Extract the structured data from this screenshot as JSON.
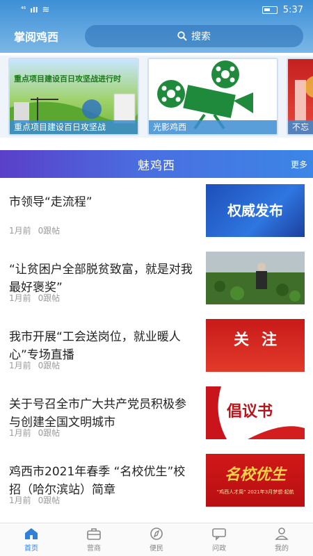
{
  "status": {
    "time": "5:37",
    "network": "⁴⁶",
    "signal": "ıll",
    "wifi": "≋"
  },
  "header": {
    "app_title": "掌阅鸡西",
    "search_label": "搜索"
  },
  "banners": [
    {
      "caption": "重点项目建设百日攻坚战",
      "image_text": "重点项目建设百日攻坚战进行时"
    },
    {
      "caption": "光影鸡西"
    },
    {
      "caption": "不忘"
    }
  ],
  "section": {
    "title": "魅鸡西",
    "more": "更多"
  },
  "articles": [
    {
      "title": "市领导“走流程”",
      "time": "1月前",
      "replies": "0跟帖",
      "thumb_text": "权威发布"
    },
    {
      "title": "“让贫困户全部脱贫致富，就是对我最好褒奖”",
      "time": "1月前",
      "replies": "0跟帖",
      "thumb_text": ""
    },
    {
      "title": "我市开展“工会送岗位，就业暖人心”专场直播",
      "time": "1月前",
      "replies": "0跟帖",
      "thumb_text": "关注"
    },
    {
      "title": "关于号召全市广大共产党员积极参与创建全国文明城市",
      "time": "1月前",
      "replies": "0跟帖",
      "thumb_text": "倡议书"
    },
    {
      "title": "鸡西市2021年春季 “名校优生”校招（哈尔滨站）简章",
      "time": "1月前",
      "replies": "0跟帖",
      "thumb_text": "名校优生",
      "thumb_sub": "“鸡西人才周” 2021年3月梦想·起航"
    }
  ],
  "tabs": [
    {
      "label": "首页",
      "icon": "home-icon"
    },
    {
      "label": "营商",
      "icon": "briefcase-icon"
    },
    {
      "label": "便民",
      "icon": "compass-icon"
    },
    {
      "label": "问政",
      "icon": "chat-icon"
    },
    {
      "label": "我的",
      "icon": "person-icon"
    }
  ],
  "colors": {
    "accent": "#2f80d8",
    "header_blue": "#3d8fd6",
    "tab_inactive": "#888888"
  }
}
